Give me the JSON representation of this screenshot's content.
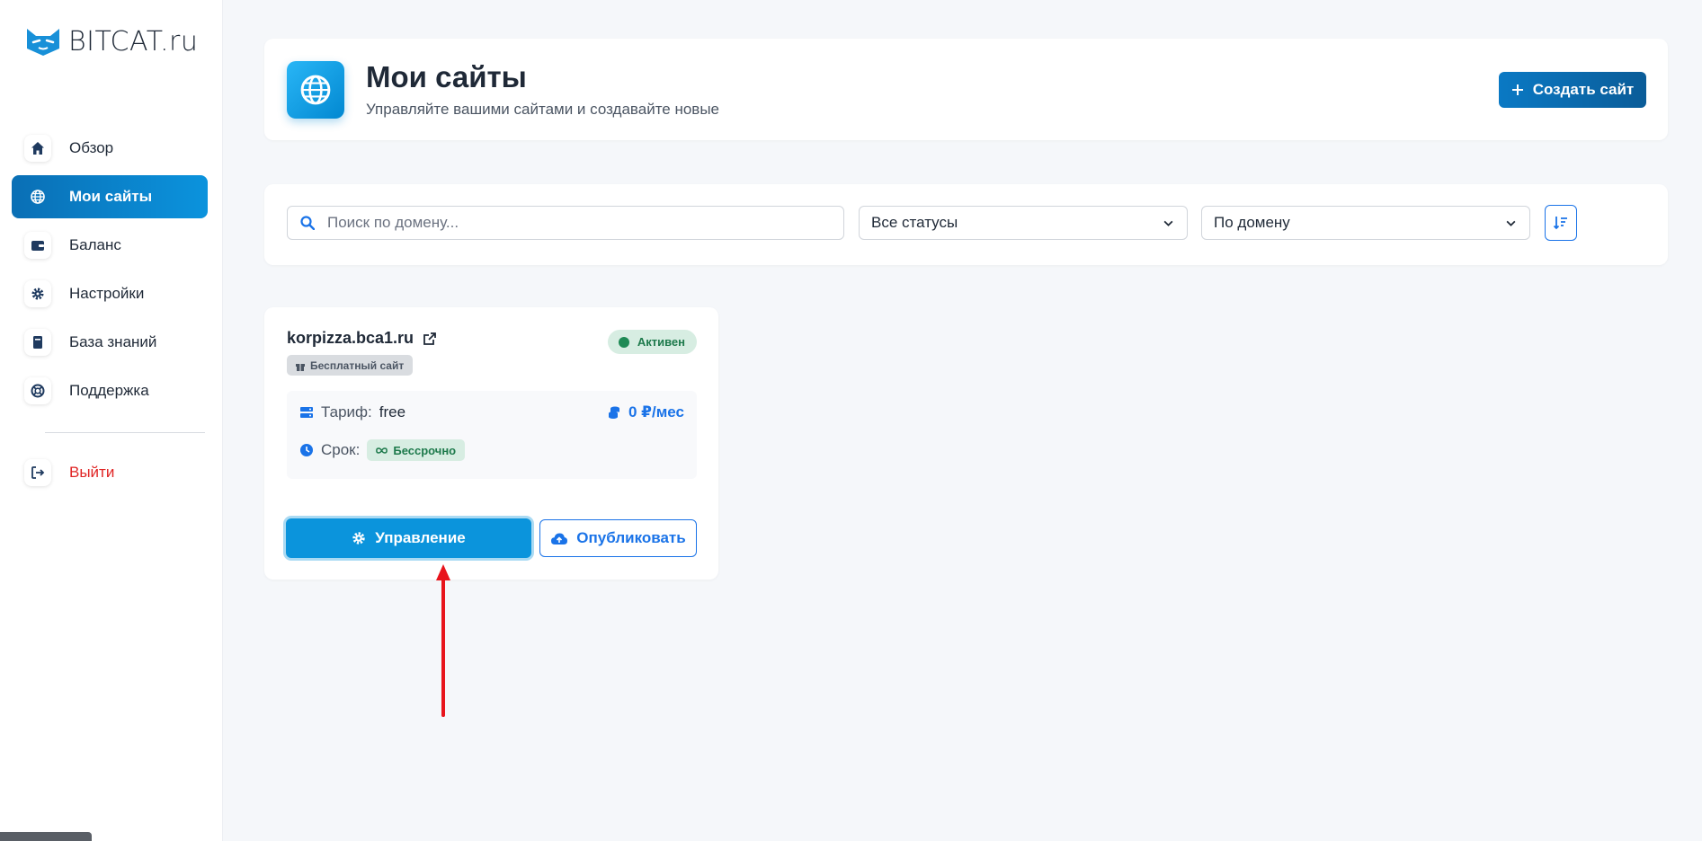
{
  "brand": {
    "logo_text": "BITCAT.ru",
    "accent": "#0b94dc"
  },
  "sidebar": {
    "items": [
      {
        "label": "Обзор",
        "icon": "home-icon"
      },
      {
        "label": "Мои сайты",
        "icon": "globe-icon",
        "active": true
      },
      {
        "label": "Баланс",
        "icon": "wallet-icon"
      },
      {
        "label": "Настройки",
        "icon": "gear-icon"
      },
      {
        "label": "База знаний",
        "icon": "book-icon"
      },
      {
        "label": "Поддержка",
        "icon": "lifebuoy-icon"
      }
    ],
    "logout_label": "Выйти"
  },
  "header": {
    "title": "Мои сайты",
    "subtitle": "Управляйте вашими сайтами и создавайте новые",
    "create_label": "Создать сайт"
  },
  "filters": {
    "search_placeholder": "Поиск по домену...",
    "status_value": "Все статусы",
    "sort_value": "По домену"
  },
  "site": {
    "domain": "korpizza.bca1.ru",
    "type_badge": "Бесплатный сайт",
    "status": "Активен",
    "tariff_label": "Тариф:",
    "tariff_value": "free",
    "price": "0 ₽/мес",
    "term_label": "Срок:",
    "term_value": "Бессрочно",
    "manage_label": "Управление",
    "publish_label": "Опубликовать"
  }
}
